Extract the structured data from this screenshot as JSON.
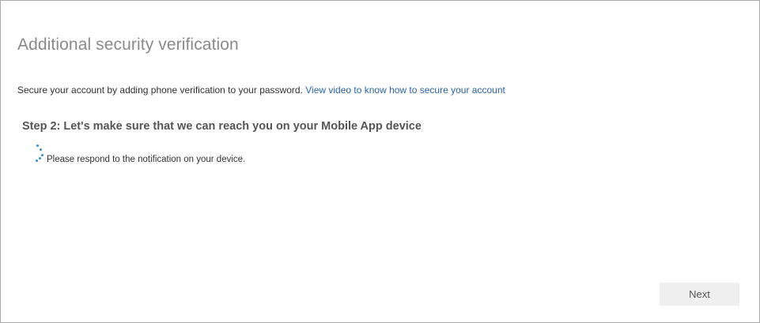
{
  "page": {
    "title": "Additional security verification",
    "intro_text": "Secure your account by adding phone verification to your password.",
    "intro_link": "View video to know how to secure your account",
    "step_heading": "Step 2: Let's make sure that we can reach you on your Mobile App device",
    "notice_text": "Please respond to the notification on your device.",
    "spinner_icon": "loading-spinner-icon",
    "accent_color": "#2a64a6"
  },
  "footer": {
    "next_label": "Next"
  }
}
